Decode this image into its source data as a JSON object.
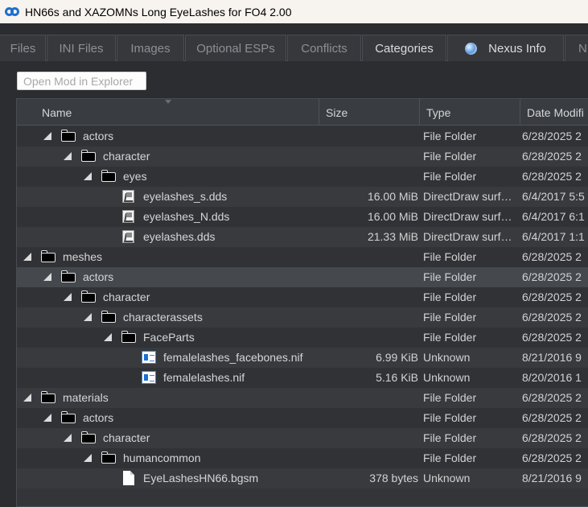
{
  "window": {
    "title": "HN66s and XAZOMNs Long EyeLashes for FO4 2.00"
  },
  "tabs": [
    {
      "label": "Files"
    },
    {
      "label": "INI Files"
    },
    {
      "label": "Images"
    },
    {
      "label": "Optional ESPs"
    },
    {
      "label": "Conflicts"
    },
    {
      "label": "Categories"
    },
    {
      "label": "Nexus Info"
    },
    {
      "label": "N"
    }
  ],
  "toolbar": {
    "open_mod_label": "Open Mod in Explorer"
  },
  "columns": {
    "name": "Name",
    "size": "Size",
    "type": "Type",
    "date": "Date Modifi"
  },
  "rows": [
    {
      "name": "actors",
      "size": "",
      "type": "File Folder",
      "date": "6/28/2025 2"
    },
    {
      "name": "character",
      "size": "",
      "type": "File Folder",
      "date": "6/28/2025 2"
    },
    {
      "name": "eyes",
      "size": "",
      "type": "File Folder",
      "date": "6/28/2025 2"
    },
    {
      "name": "eyelashes_s.dds",
      "size": "16.00 MiB",
      "type": "DirectDraw surf…",
      "date": "6/4/2017 5:5"
    },
    {
      "name": "eyelashes_N.dds",
      "size": "16.00 MiB",
      "type": "DirectDraw surf…",
      "date": "6/4/2017 6:1"
    },
    {
      "name": "eyelashes.dds",
      "size": "21.33 MiB",
      "type": "DirectDraw surf…",
      "date": "6/4/2017 1:1"
    },
    {
      "name": "meshes",
      "size": "",
      "type": "File Folder",
      "date": "6/28/2025 2"
    },
    {
      "name": "actors",
      "size": "",
      "type": "File Folder",
      "date": "6/28/2025 2"
    },
    {
      "name": "character",
      "size": "",
      "type": "File Folder",
      "date": "6/28/2025 2"
    },
    {
      "name": "characterassets",
      "size": "",
      "type": "File Folder",
      "date": "6/28/2025 2"
    },
    {
      "name": "FaceParts",
      "size": "",
      "type": "File Folder",
      "date": "6/28/2025 2"
    },
    {
      "name": "femalelashes_facebones.nif",
      "size": "6.99 KiB",
      "type": "Unknown",
      "date": "8/21/2016 9"
    },
    {
      "name": "femalelashes.nif",
      "size": "5.16 KiB",
      "type": "Unknown",
      "date": "8/20/2016 1"
    },
    {
      "name": "materials",
      "size": "",
      "type": "File Folder",
      "date": "6/28/2025 2"
    },
    {
      "name": "actors",
      "size": "",
      "type": "File Folder",
      "date": "6/28/2025 2"
    },
    {
      "name": "character",
      "size": "",
      "type": "File Folder",
      "date": "6/28/2025 2"
    },
    {
      "name": "humancommon",
      "size": "",
      "type": "File Folder",
      "date": "6/28/2025 2"
    },
    {
      "name": "EyeLashesHN66.bgsm",
      "size": "378 bytes",
      "type": "Unknown",
      "date": "8/21/2016 9"
    }
  ]
}
